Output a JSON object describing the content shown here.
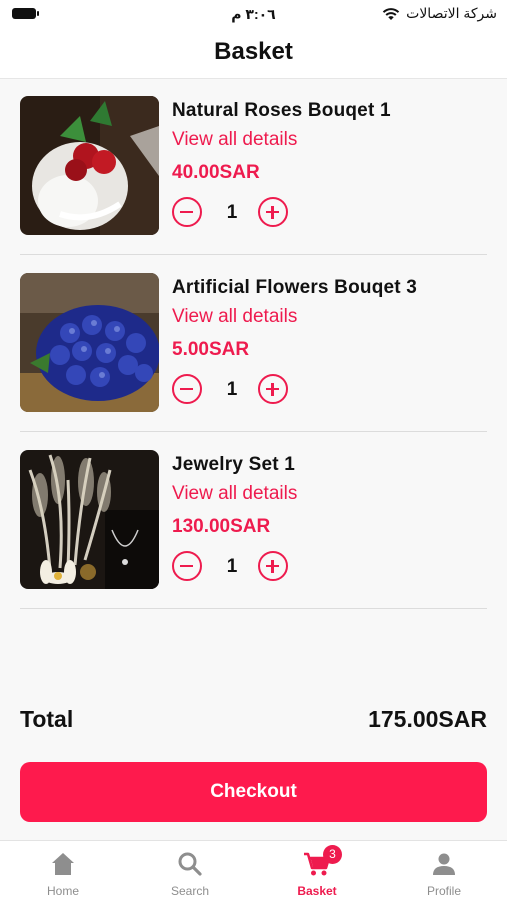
{
  "status_bar": {
    "time": "٣:٠٦ م",
    "carrier": "شركة الاتصالات"
  },
  "header": {
    "title": "Basket"
  },
  "basket": {
    "items": [
      {
        "name": "Natural Roses Bouqet 1",
        "details_label": "View all details",
        "price": "40.00SAR",
        "quantity": "1",
        "image": "red-roses-bouquet"
      },
      {
        "name": "Artificial Flowers Bouqet 3",
        "details_label": "View all details",
        "price": "5.00SAR",
        "quantity": "1",
        "image": "blue-roses-bouquet"
      },
      {
        "name": "Jewelry Set 1",
        "details_label": "View all details",
        "price": "130.00SAR",
        "quantity": "1",
        "image": "pampas-necklace-display"
      }
    ],
    "total_label": "Total",
    "total_value": "175.00SAR",
    "checkout_label": "Checkout"
  },
  "tab_bar": {
    "tabs": [
      {
        "label": "Home",
        "icon": "home-icon",
        "active": false
      },
      {
        "label": "Search",
        "icon": "search-icon",
        "active": false
      },
      {
        "label": "Basket",
        "icon": "cart-icon",
        "active": true,
        "badge": "3"
      },
      {
        "label": "Profile",
        "icon": "person-icon",
        "active": false
      }
    ]
  },
  "colors": {
    "accent": "#ee1b4e",
    "button": "#fe1a4d",
    "inactive": "#8e8e8e"
  }
}
